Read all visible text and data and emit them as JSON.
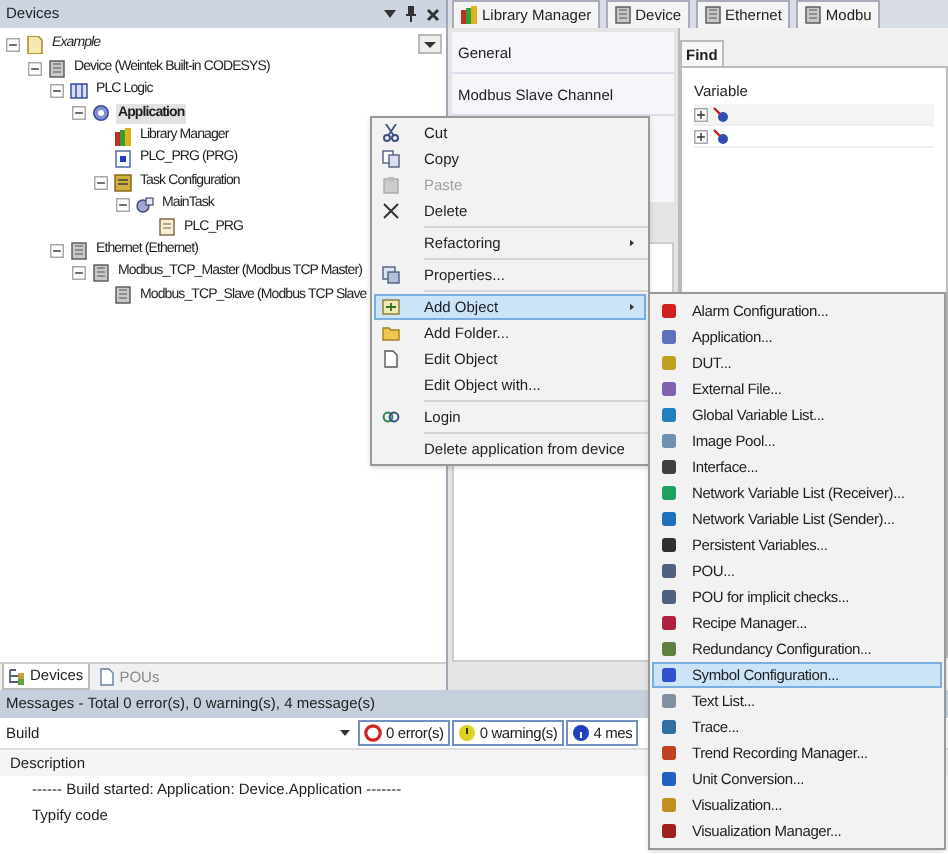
{
  "devices_panel": {
    "title": "Devices",
    "tree": [
      {
        "label": "Example",
        "kind": "project",
        "expanded": true,
        "selected": false,
        "children": [
          {
            "label": "Device (Weintek Built-in CODESYS)",
            "kind": "device",
            "expanded": true,
            "selected": false,
            "children": [
              {
                "label": "PLC Logic",
                "kind": "plc",
                "expanded": true,
                "selected": false,
                "children": [
                  {
                    "label": "Application",
                    "kind": "application",
                    "expanded": true,
                    "selected": true,
                    "children": [
                      {
                        "label": "Library Manager",
                        "kind": "library",
                        "selected": false
                      },
                      {
                        "label": "PLC_PRG (PRG)",
                        "kind": "pou",
                        "selected": false
                      },
                      {
                        "label": "Task Configuration",
                        "kind": "tasks",
                        "expanded": true,
                        "selected": false,
                        "children": [
                          {
                            "label": "MainTask",
                            "kind": "task",
                            "expanded": true,
                            "selected": false,
                            "children": [
                              {
                                "label": "PLC_PRG",
                                "kind": "call",
                                "selected": false
                              }
                            ]
                          }
                        ]
                      }
                    ]
                  }
                ]
              },
              {
                "label": "Ethernet (Ethernet)",
                "kind": "device",
                "expanded": true,
                "selected": false,
                "children": [
                  {
                    "label": "Modbus_TCP_Master (Modbus TCP Master)",
                    "kind": "device",
                    "expanded": true,
                    "selected": false,
                    "children": [
                      {
                        "label": "Modbus_TCP_Slave (Modbus TCP Slave",
                        "kind": "device",
                        "selected": false
                      }
                    ]
                  }
                ]
              }
            ]
          }
        ]
      }
    ],
    "bottom_tabs": [
      {
        "label": "Devices",
        "selected": true
      },
      {
        "label": "POUs",
        "selected": false
      }
    ]
  },
  "editor_tabs": [
    {
      "label": "Library Manager",
      "kind": "library"
    },
    {
      "label": "Device",
      "kind": "device"
    },
    {
      "label": "Ethernet",
      "kind": "device"
    },
    {
      "label": "Modbu",
      "kind": "device"
    }
  ],
  "editor": {
    "sections": [
      "General",
      "Modbus Slave Channel"
    ],
    "find_tab": "Find",
    "variable_header": "Variable",
    "variable_rows": [
      {
        "expanded": false
      },
      {
        "expanded": false
      }
    ]
  },
  "context_menu": {
    "groups": [
      [
        {
          "label": "Cut",
          "kind": "cut",
          "disabled": false,
          "selected": false
        },
        {
          "label": "Copy",
          "kind": "copy",
          "disabled": false,
          "selected": false
        },
        {
          "label": "Paste",
          "kind": "paste",
          "disabled": true,
          "selected": false
        },
        {
          "label": "Delete",
          "kind": "delete",
          "disabled": false,
          "selected": false
        }
      ],
      [
        {
          "label": "Refactoring",
          "kind": "none",
          "disabled": false,
          "selected": false,
          "submenu": true
        }
      ],
      [
        {
          "label": "Properties...",
          "kind": "properties",
          "disabled": false,
          "selected": false
        }
      ],
      [
        {
          "label": "Add Object",
          "kind": "add",
          "disabled": false,
          "selected": true,
          "submenu": true
        },
        {
          "label": "Add Folder...",
          "kind": "folder",
          "disabled": false,
          "selected": false
        },
        {
          "label": "Edit Object",
          "kind": "edit",
          "disabled": false,
          "selected": false
        },
        {
          "label": "Edit Object with...",
          "kind": "none",
          "disabled": false,
          "selected": false
        }
      ],
      [
        {
          "label": "Login",
          "kind": "login",
          "disabled": false,
          "selected": false
        }
      ],
      [
        {
          "label": "Delete application from device",
          "kind": "none",
          "disabled": false,
          "selected": false
        }
      ]
    ]
  },
  "submenu": [
    {
      "label": "Alarm Configuration...",
      "color": "#d02020",
      "selected": false
    },
    {
      "label": "Application...",
      "color": "#6070c0",
      "selected": false
    },
    {
      "label": "DUT...",
      "color": "#c0a020",
      "selected": false
    },
    {
      "label": "External File...",
      "color": "#8060b0",
      "selected": false
    },
    {
      "label": "Global Variable List...",
      "color": "#2080c0",
      "selected": false
    },
    {
      "label": "Image Pool...",
      "color": "#7090b0",
      "selected": false
    },
    {
      "label": "Interface...",
      "color": "#404040",
      "selected": false
    },
    {
      "label": "Network Variable List (Receiver)...",
      "color": "#20a060",
      "selected": false
    },
    {
      "label": "Network Variable List (Sender)...",
      "color": "#2070c0",
      "selected": false
    },
    {
      "label": "Persistent Variables...",
      "color": "#303030",
      "selected": false
    },
    {
      "label": "POU...",
      "color": "#506080",
      "selected": false
    },
    {
      "label": "POU for implicit checks...",
      "color": "#506080",
      "selected": false
    },
    {
      "label": "Recipe Manager...",
      "color": "#b02040",
      "selected": false
    },
    {
      "label": "Redundancy Configuration...",
      "color": "#608040",
      "selected": false
    },
    {
      "label": "Symbol Configuration...",
      "color": "#3050d0",
      "selected": true
    },
    {
      "label": "Text List...",
      "color": "#8090a0",
      "selected": false
    },
    {
      "label": "Trace...",
      "color": "#3070a0",
      "selected": false
    },
    {
      "label": "Trend Recording Manager...",
      "color": "#c04020",
      "selected": false
    },
    {
      "label": "Unit Conversion...",
      "color": "#2060c0",
      "selected": false
    },
    {
      "label": "Visualization...",
      "color": "#c09020",
      "selected": false
    },
    {
      "label": "Visualization Manager...",
      "color": "#a02020",
      "selected": false
    }
  ],
  "messages": {
    "title": "Messages - Total 0 error(s), 0 warning(s), 4 message(s)",
    "source": "Build",
    "filters": [
      {
        "label": "0 error(s)",
        "kind": "error"
      },
      {
        "label": "0 warning(s)",
        "kind": "warning"
      },
      {
        "label": "4 mes",
        "kind": "info"
      }
    ],
    "column": "Description",
    "lines": [
      "------ Build started: Application: Device.Application -------",
      "Typify code"
    ]
  }
}
